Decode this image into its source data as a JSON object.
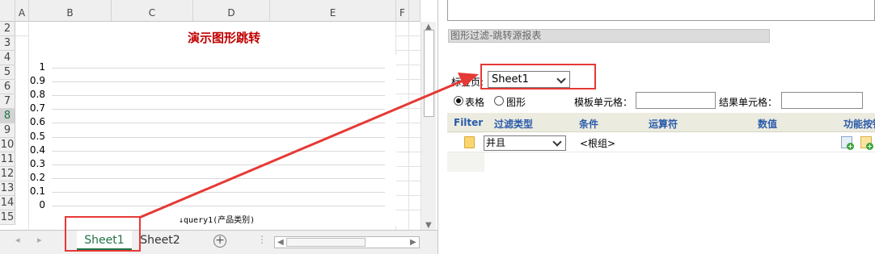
{
  "spreadsheet": {
    "columns": [
      "A",
      "B",
      "C",
      "D",
      "E",
      "F"
    ],
    "rows": [
      "2",
      "3",
      "4",
      "5",
      "6",
      "7",
      "8",
      "9",
      "10",
      "11",
      "12",
      "13",
      "14",
      "15"
    ],
    "selected_row": "8",
    "chart": {
      "title": "演示图形跳转",
      "x_label": "↓query1(产品类别)"
    },
    "tabs": [
      "Sheet1",
      "Sheet2"
    ],
    "active_tab": "Sheet1",
    "tab_nav": {
      "prev": "◂",
      "next": "▸",
      "add": "+",
      "dots": "⋮"
    }
  },
  "chart_data": {
    "type": "bar",
    "title": "演示图形跳转",
    "xlabel": "↓query1(产品类别)",
    "ylabel": "",
    "ylim": [
      0,
      1
    ],
    "y_ticks": [
      "1",
      "0.9",
      "0.8",
      "0.7",
      "0.6",
      "0.5",
      "0.4",
      "0.3",
      "0.2",
      "0.1",
      "0"
    ],
    "categories": [],
    "values": []
  },
  "panel": {
    "section_title": "图形过滤-跳转源报表",
    "sheet_label": "标签页:",
    "sheet_value": "Sheet1",
    "radio_table": "表格",
    "radio_chart": "图形",
    "template_cell_label": "模板单元格：",
    "result_cell_label": "结果单元格：",
    "filter_headers": [
      "Filter",
      "过滤类型",
      "条件",
      "运算符",
      "数值",
      "功能按钮"
    ],
    "filter_row": {
      "type": "并且",
      "condition": "<根组>"
    }
  },
  "colors": {
    "annotation": "#e53935",
    "title_red": "#c00000",
    "header_blue": "#2a5bab",
    "excel_green": "#217346"
  }
}
